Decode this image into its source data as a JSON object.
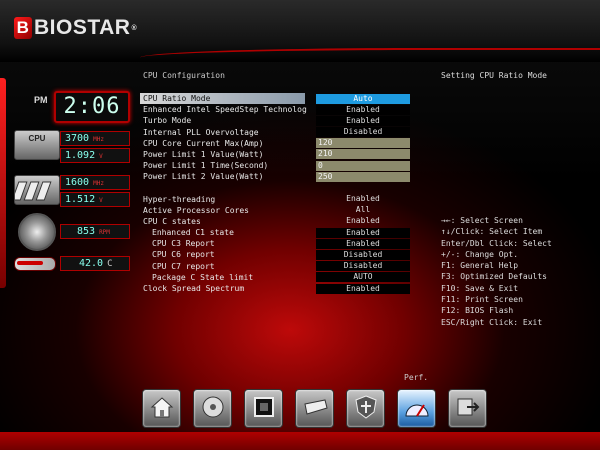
{
  "brand": {
    "name": "BIOSTAR",
    "mark": "B",
    "reg": "®"
  },
  "status_panel": {
    "meridiem": "PM",
    "time": "2:06",
    "cpu_label": "CPU",
    "cpu_freq": "3700",
    "cpu_freq_unit": "MHz",
    "cpu_volt": "1.092",
    "cpu_volt_unit": "V",
    "mem_freq": "1600",
    "mem_freq_unit": "MHz",
    "mem_volt": "1.512",
    "mem_volt_unit": "V",
    "fan_rpm": "853",
    "fan_unit": "RPM",
    "temp": "42.0",
    "temp_unit": "C"
  },
  "section_title": "CPU Configuration",
  "help_title": "Setting CPU Ratio Mode",
  "settings": [
    {
      "label": "CPU Ratio Mode",
      "value": "Auto",
      "style": "sel"
    },
    {
      "label": "Enhanced Intel SpeedStep Technolog",
      "value": "Enabled",
      "style": "boxed"
    },
    {
      "label": "Turbo Mode",
      "value": "Enabled",
      "style": "boxed"
    },
    {
      "label": "Internal PLL Overvoltage",
      "value": "Disabled",
      "style": "boxed"
    },
    {
      "label": "CPU Core Current Max(Amp)",
      "value": "120",
      "style": "input"
    },
    {
      "label": "Power Limit 1 Value(Watt)",
      "value": "210",
      "style": "input"
    },
    {
      "label": "Power Limit 1 Time(Second)",
      "value": "0",
      "style": "input"
    },
    {
      "label": "Power Limit 2 Value(Watt)",
      "value": "250",
      "style": "input"
    },
    {
      "label": "",
      "value": "",
      "style": "spacer"
    },
    {
      "label": "Hyper-threading",
      "value": "Enabled",
      "style": "plain"
    },
    {
      "label": "Active Processor Cores",
      "value": "All",
      "style": "plain"
    },
    {
      "label": "CPU C states",
      "value": "Enabled",
      "style": "plain"
    },
    {
      "label": "Enhanced C1 state",
      "value": "Enabled",
      "style": "boxed",
      "indent": true
    },
    {
      "label": "CPU C3 Report",
      "value": "Enabled",
      "style": "boxed",
      "indent": true
    },
    {
      "label": "CPU C6 report",
      "value": "Disabled",
      "style": "boxed",
      "indent": true
    },
    {
      "label": "CPU C7 report",
      "value": "Disabled",
      "style": "boxed",
      "indent": true
    },
    {
      "label": "Package C State limit",
      "value": "AUTO",
      "style": "boxed",
      "indent": true
    },
    {
      "label": "Clock Spread Spectrum",
      "value": "Enabled",
      "style": "boxed"
    }
  ],
  "help_keys": [
    "→←: Select Screen",
    "↑↓/Click: Select Item",
    "Enter/Dbl Click: Select",
    "+/-: Change Opt.",
    "F1: General Help",
    "F3: Optimized Defaults",
    "F10: Save & Exit",
    "F11: Print Screen",
    "F12: BIOS Flash",
    "ESC/Right Click: Exit"
  ],
  "nav": {
    "active_label": "Perf.",
    "items": [
      {
        "name": "home-icon"
      },
      {
        "name": "disc-icon"
      },
      {
        "name": "chip-icon"
      },
      {
        "name": "drive-icon"
      },
      {
        "name": "shield-icon"
      },
      {
        "name": "performance-icon",
        "active": true
      },
      {
        "name": "exit-icon"
      }
    ]
  },
  "colors": {
    "accent_red": "#b00000",
    "selected_blue": "#1e9be0",
    "input_olive": "#8c8a6c"
  }
}
